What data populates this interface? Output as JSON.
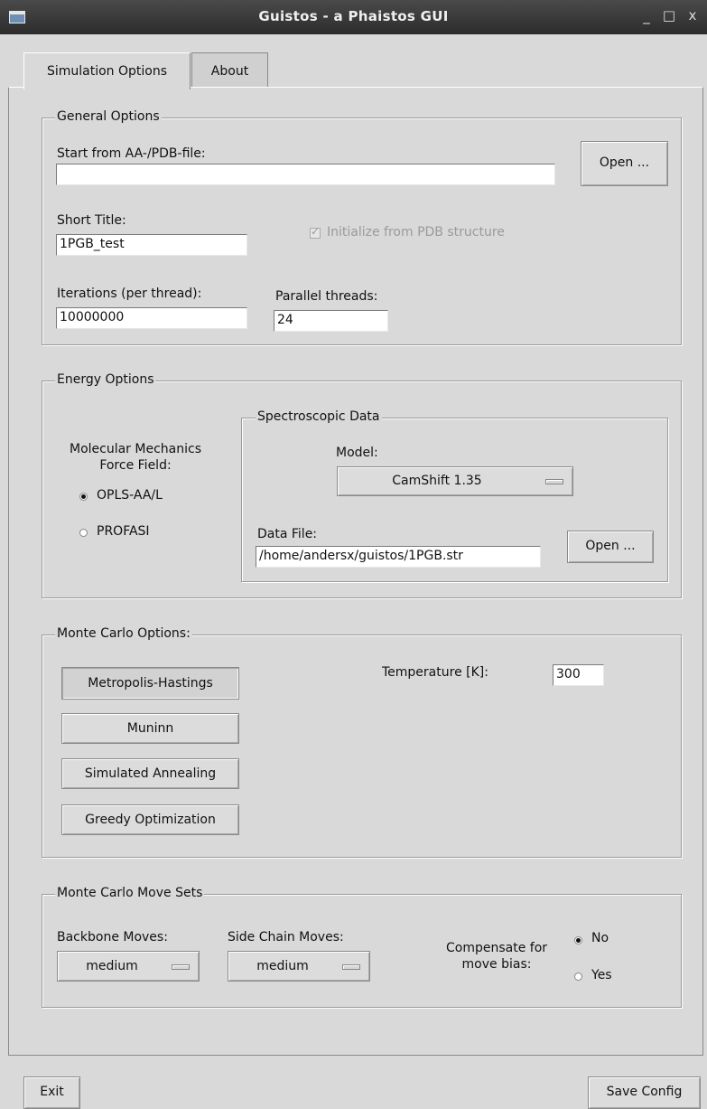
{
  "window": {
    "title": "Guistos - a Phaistos GUI",
    "minimize_glyph": "_",
    "maximize_glyph": "□",
    "close_glyph": "x"
  },
  "tabs": [
    {
      "label": "Simulation Options"
    },
    {
      "label": "About"
    }
  ],
  "general": {
    "legend": "General Options",
    "start_label": "Start from AA-/PDB-file:",
    "start_value": "",
    "open_label": "Open ...",
    "title_label": "Short Title:",
    "title_value": "1PGB_test",
    "init_label": "Initialize from PDB structure",
    "iterations_label": "Iterations (per thread):",
    "iterations_value": "10000000",
    "threads_label": "Parallel threads:",
    "threads_value": "24"
  },
  "energy": {
    "legend": "Energy Options",
    "mm_label_line1": "Molecular Mechanics",
    "mm_label_line2": "Force Field:",
    "ff_options": [
      {
        "label": "OPLS-AA/L",
        "selected": true
      },
      {
        "label": "PROFASI",
        "selected": false
      }
    ],
    "spectro": {
      "legend": "Spectroscopic Data",
      "model_label": "Model:",
      "model_value": "CamShift 1.35",
      "datafile_label": "Data File:",
      "datafile_value": "/home/andersx/guistos/1PGB.str",
      "open_label": "Open ..."
    }
  },
  "montecarlo": {
    "legend": "Monte Carlo Options:",
    "buttons": [
      "Metropolis-Hastings",
      "Muninn",
      "Simulated Annealing",
      "Greedy Optimization"
    ],
    "temperature_label": "Temperature [K]:",
    "temperature_value": "300"
  },
  "movesets": {
    "legend": "Monte Carlo Move Sets",
    "backbone_label": "Backbone Moves:",
    "backbone_value": "medium",
    "sidechain_label": "Side Chain Moves:",
    "sidechain_value": "medium",
    "compensate_line1": "Compensate for",
    "compensate_line2": "move bias:",
    "compensate_options": [
      {
        "label": "No",
        "selected": true
      },
      {
        "label": "Yes",
        "selected": false
      }
    ]
  },
  "footer": {
    "exit_label": "Exit",
    "save_label": "Save Config"
  }
}
